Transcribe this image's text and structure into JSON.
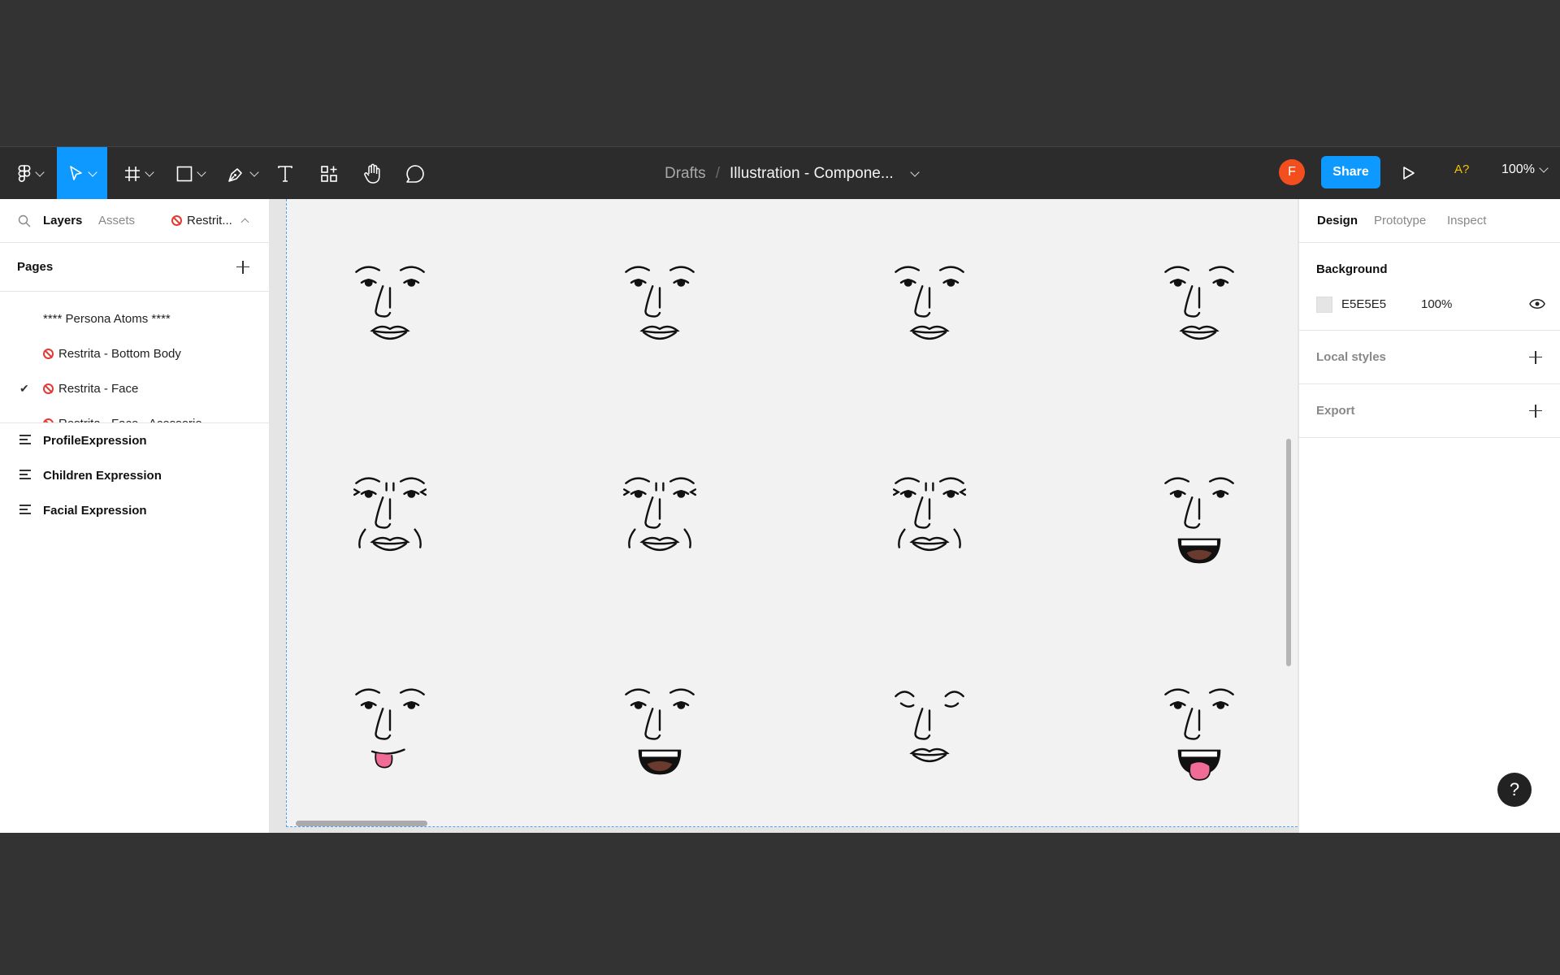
{
  "toolbar": {
    "breadcrumb": "Drafts",
    "separator": "/",
    "file_name": "Illustration - Compone...",
    "avatar_initial": "F",
    "share_label": "Share",
    "font_warning": "A?",
    "zoom_level": "100%",
    "icons": [
      "figma-menu-icon",
      "move-tool-icon",
      "frame-tool-icon",
      "shape-tool-icon",
      "pen-tool-icon",
      "text-tool-icon",
      "resources-icon",
      "hand-tool-icon",
      "comment-tool-icon",
      "present-icon"
    ]
  },
  "left_panel": {
    "tabs": [
      "Layers",
      "Assets"
    ],
    "current_page_short": "Restrit...",
    "pages_label": "Pages",
    "pages": [
      {
        "label": "**** Persona Atoms ****",
        "restricted": false,
        "current": false
      },
      {
        "label": "Restrita - Bottom Body",
        "restricted": true,
        "current": false
      },
      {
        "label": "Restrita - Face",
        "restricted": true,
        "current": true
      },
      {
        "label": "Restrita - Face - Acessorio",
        "restricted": true,
        "current": false
      }
    ],
    "layers": [
      "ProfileExpression",
      "Children Expression",
      "Facial Expression"
    ]
  },
  "canvas": {
    "faces": [
      [
        "neutral",
        "neutral",
        "neutral",
        "neutral"
      ],
      [
        "squint",
        "squint",
        "squint",
        "laughing"
      ],
      [
        "tongue-out",
        "laughing",
        "closed-eyes",
        "laughing-tongue"
      ]
    ]
  },
  "right_panel": {
    "tabs": [
      "Design",
      "Prototype",
      "Inspect"
    ],
    "background_label": "Background",
    "background_hex": "E5E5E5",
    "background_opacity": "100%",
    "local_styles_label": "Local styles",
    "export_label": "Export"
  },
  "help_label": "?",
  "colors": {
    "accent": "#0d99ff",
    "toolbar": "#2c2c2c",
    "avatar": "#f24e1e",
    "tongue": "#f06b96",
    "mouth_inner": "#6b3a2e"
  }
}
